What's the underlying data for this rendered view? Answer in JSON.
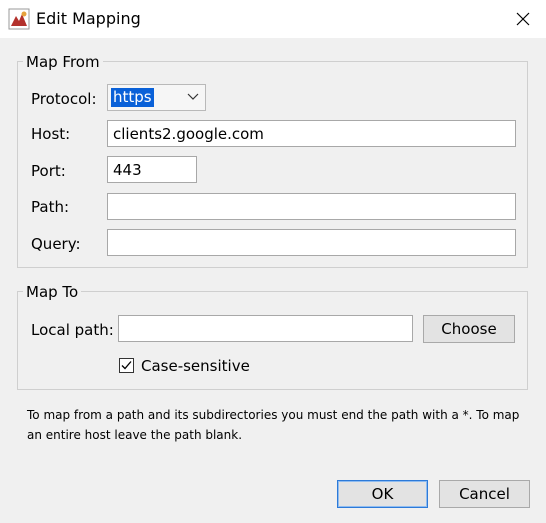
{
  "window": {
    "title": "Edit Mapping",
    "close_icon": "close-icon",
    "app_icon": "app-icon"
  },
  "map_from": {
    "legend": "Map From",
    "protocol": {
      "label": "Protocol:",
      "value": "https"
    },
    "host": {
      "label": "Host:",
      "value": "clients2.google.com"
    },
    "port": {
      "label": "Port:",
      "value": "443"
    },
    "path": {
      "label": "Path:",
      "value": ""
    },
    "query": {
      "label": "Query:",
      "value": ""
    }
  },
  "map_to": {
    "legend": "Map To",
    "local_path": {
      "label": "Local path:",
      "value": ""
    },
    "choose_label": "Choose",
    "case_sensitive": {
      "label": "Case-sensitive",
      "checked": true
    }
  },
  "info": "To map from a path and its subdirectories you must end the path with a *. To map an entire host leave the path blank.",
  "buttons": {
    "ok": "OK",
    "cancel": "Cancel"
  },
  "colors": {
    "selection": "#0a61d8",
    "primary_border": "#2d7ad8"
  }
}
